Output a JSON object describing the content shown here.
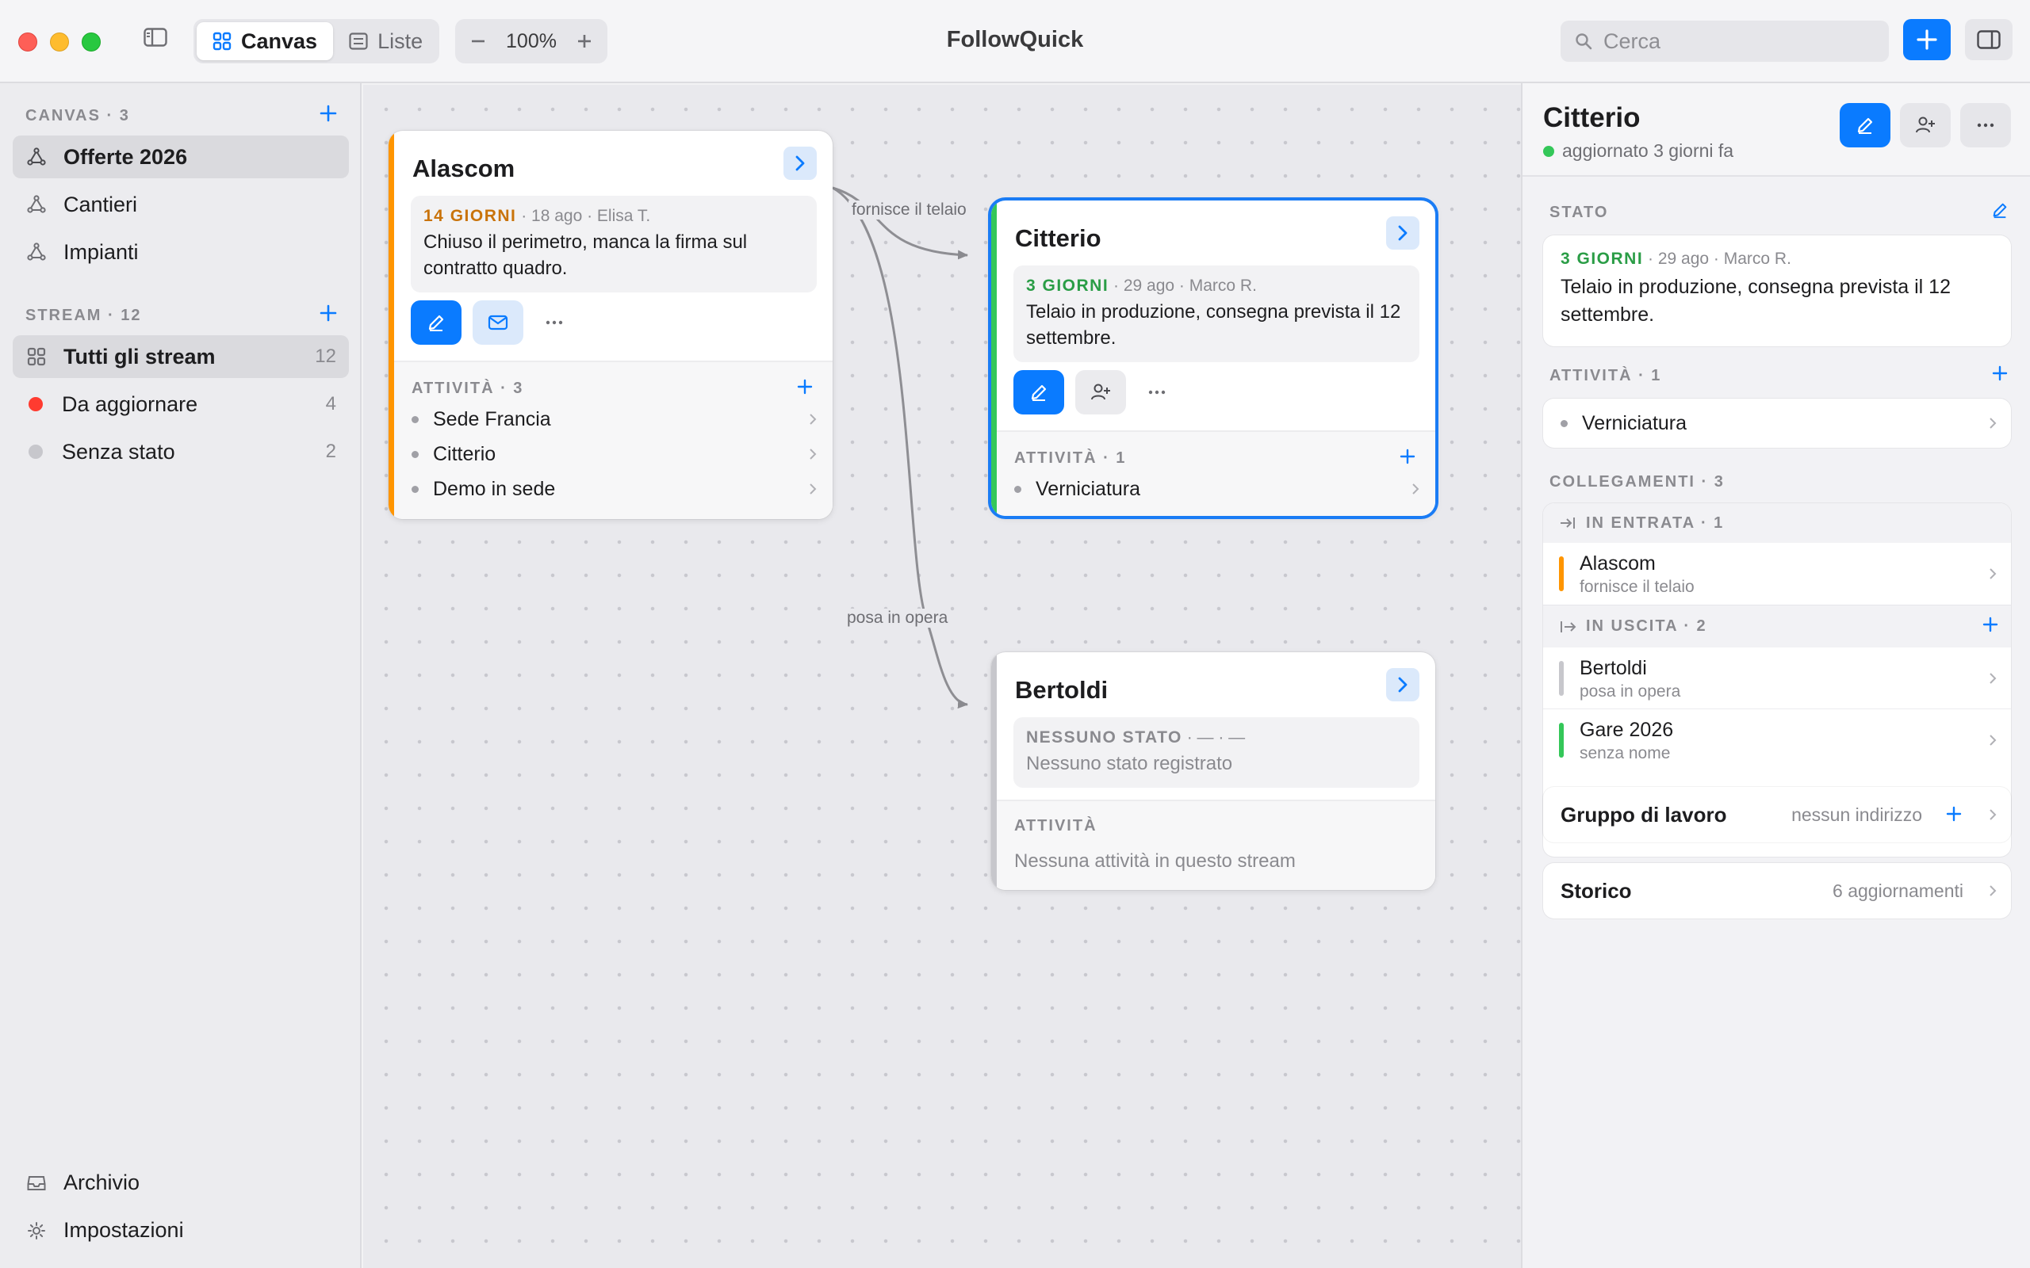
{
  "window": {
    "title": "FollowQuick",
    "tabs": [
      {
        "label": "Canvas"
      },
      {
        "label": "Liste"
      }
    ],
    "zoom": "100%",
    "search_placeholder": "Cerca"
  },
  "sidebar": {
    "canvas_header": "CANVAS · 3",
    "canvas_items": [
      {
        "label": "Offerte 2026",
        "icon": "canvas-network-icon",
        "selected": true
      },
      {
        "label": "Cantieri",
        "icon": "canvas-network-icon"
      },
      {
        "label": "Impianti",
        "icon": "canvas-network-icon"
      }
    ],
    "stream_header": "STREAM · 12",
    "stream_items": [
      {
        "label": "Tutti gli stream",
        "count": "12",
        "icon": "grid-icon",
        "selected": true
      },
      {
        "label": "Da aggiornare",
        "count": "4",
        "color": "#ff3b30"
      },
      {
        "label": "Senza stato",
        "count": "2",
        "color": "#c7c7cc"
      }
    ],
    "archive_label": "Archivio",
    "settings_label": "Impostazioni"
  },
  "canvas": {
    "edges": [
      {
        "label": "fornisce il telaio"
      },
      {
        "label": "posa in opera"
      }
    ],
    "cards": {
      "alascom": {
        "title": "Alascom",
        "accent": "#ff9500",
        "status_days": "14 GIORNI",
        "status_meta": " · 18 ago · Elisa T.",
        "status_color": "#c9730a",
        "status_text": "Chiuso il perimetro, manca la firma sul contratto quadro.",
        "activities_header": "ATTIVITÀ · 3",
        "activities": [
          "Sede Francia",
          "Citterio",
          "Demo in sede"
        ]
      },
      "citterio": {
        "title": "Citterio",
        "accent": "#34c759",
        "status_days": "3 GIORNI",
        "status_meta": " · 29 ago · Marco R.",
        "status_color": "#2a9d46",
        "status_text": "Telaio in produzione, consegna prevista il 12 settembre.",
        "activities_header": "ATTIVITÀ · 1",
        "activities": [
          "Verniciatura"
        ]
      },
      "bertoldi": {
        "title": "Bertoldi",
        "accent": "#c7c7cc",
        "status_days": "NESSUNO STATO",
        "status_meta": " · — · —",
        "status_color": "#8a8a8f",
        "status_text": "Nessuno stato registrato",
        "activities_header": "ATTIVITÀ",
        "empty_activities": "Nessuna attività in questo stream"
      }
    }
  },
  "inspector": {
    "title": "Citterio",
    "subtitle": "aggiornato 3 giorni fa",
    "state_header": "STATO",
    "state_days": "3 GIORNI",
    "state_meta": " · 29 ago · Marco R.",
    "state_text": "Telaio in produzione, consegna prevista il 12 settembre.",
    "activities_header": "ATTIVITÀ · 1",
    "activities": [
      "Verniciatura"
    ],
    "links_header": "COLLEGAMENTI · 3",
    "incoming_header": "IN ENTRATA · 1",
    "incoming": [
      {
        "name": "Alascom",
        "sub": "fornisce il telaio",
        "color": "#ff9500"
      }
    ],
    "outgoing_header": "IN USCITA · 2",
    "outgoing": [
      {
        "name": "Bertoldi",
        "sub": "posa in opera",
        "color": "#c7c7cc"
      },
      {
        "name": "Gare 2026",
        "sub": "senza nome",
        "color": "#34c759"
      }
    ],
    "workgroup_label": "Gruppo di lavoro",
    "workgroup_value": "nessun indirizzo",
    "history_label": "Storico",
    "history_value": "6 aggiornamenti"
  },
  "colors": {
    "accent": "#0a7bff"
  }
}
